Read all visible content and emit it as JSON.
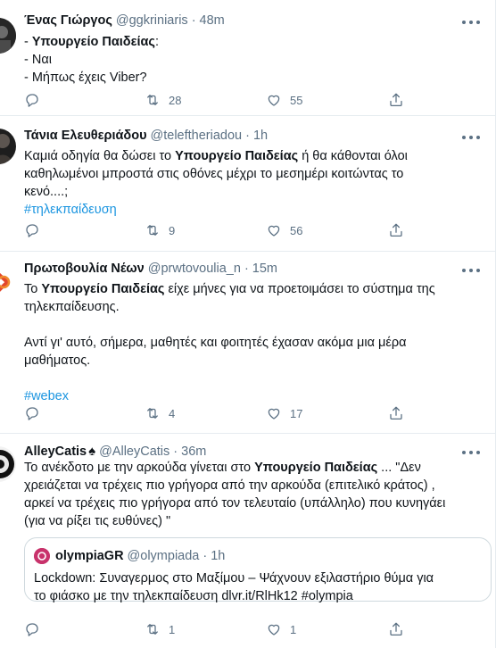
{
  "tweets": [
    {
      "name": "Ένας Γιώργος",
      "handle": "@ggkriniaris",
      "dot": "·",
      "time": "48m",
      "lines": [
        {
          "pre": "- ",
          "bold": "Υπουργείο Παιδείας",
          "post": ":"
        },
        {
          "pre": "- Ναι",
          "bold": "",
          "post": ""
        },
        {
          "pre": "- Μήπως έχεις Viber?",
          "bold": "",
          "post": ""
        }
      ],
      "retweets": "28",
      "likes": "55",
      "avatar_color": "#222222"
    },
    {
      "name": "Τάνια Ελευθεριάδου",
      "handle": "@teleftheriadou",
      "dot": "·",
      "time": "1h",
      "text_pre": "Καμιά οδηγία θα δώσει το ",
      "text_bold": "Υπουργείο Παιδείας",
      "text_post_line1": " ή θα κάθονται όλοι",
      "line2": "καθηλωμένοι μπροστά στις οθόνες μέχρι το μεσημέρι κοιτώντας το",
      "line3": "κενό....;",
      "hashtag": "#τηλεκπαίδευση",
      "retweets": "9",
      "likes": "56",
      "avatar_color": "#3a3a3a"
    },
    {
      "name": "Πρωτοβουλία Νέων",
      "handle": "@prwtovoulia_n",
      "dot": "·",
      "time": "15m",
      "line1_pre": "Το ",
      "line1_bold": "Υπουργείο Παιδείας",
      "line1_post": " είχε μήνες για να προετοιμάσει το σύστημα της",
      "line2": "τηλεκπαίδευσης.",
      "line3": "Αντί γι' αυτό, σήμερα, μαθητές και φοιτητές έχασαν ακόμα μια μέρα",
      "line4": "μαθήματος.",
      "hashtag": "#webex",
      "retweets": "4",
      "likes": "17",
      "avatar_color": "#e2472b"
    },
    {
      "name": "AlleyCatis",
      "badge": "♠",
      "handle": "@AlleyCatis",
      "dot": "·",
      "time": "36m",
      "line1_pre": "Το ανέκδοτο με την αρκούδα γίνεται στο ",
      "line1_bold": "Υπουργείο Παιδείας",
      "line1_post": " ... \"Δεν",
      "line2": "χρειάζεται να τρέχεις πιο γρήγορα από την αρκούδα (επιτελικό κράτος) ,",
      "line3": "αρκεί να τρέχεις πιο γρήγορα από τον τελευταίο (υπάλληλο) που κυνηγάει",
      "line4": "(για να ρίξει τις ευθύνες) \"",
      "quote": {
        "name": "olympiaGR",
        "handle": "@olympiada",
        "dot": "·",
        "time": "1h",
        "line1": "Lockdown: Συναγερμος στο Μαξίμου – Ψάχνουν εξιλαστήριο θύμα για",
        "line2": "το φιάσκο με την τηλεκπαίδευση dlvr.it/RlHk12 #olympia"
      },
      "retweets": "1",
      "likes": "1",
      "avatar_color": "#111111"
    }
  ]
}
